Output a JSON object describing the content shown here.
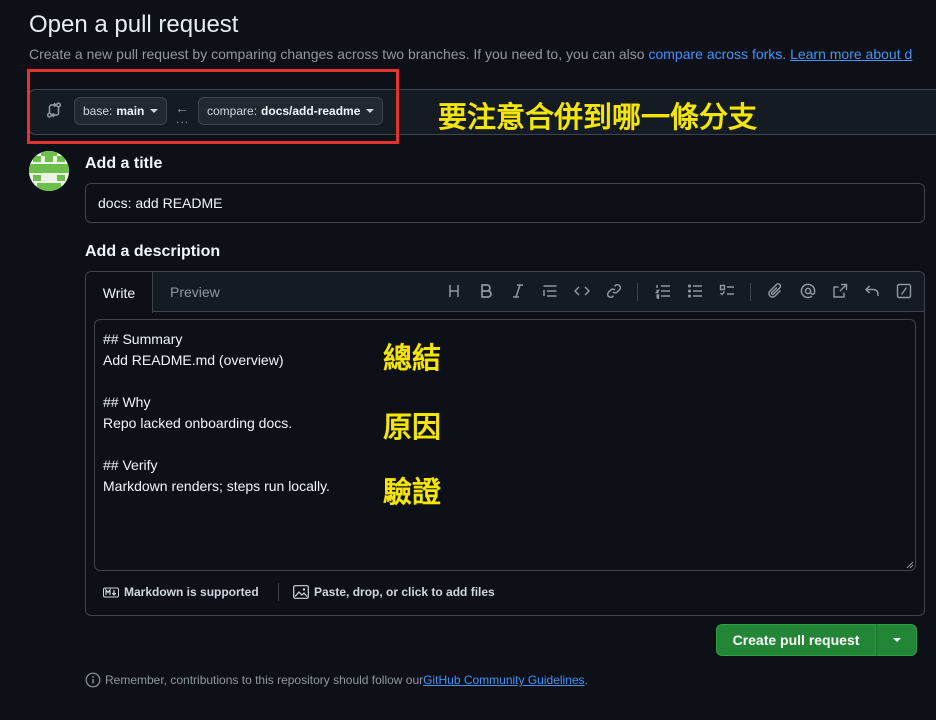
{
  "page": {
    "title": "Open a pull request",
    "subtitle_text": "Create a new pull request by comparing changes across two branches. If you need to, you can also ",
    "subtitle_link1": "compare across forks",
    "subtitle_link2": "Learn more about d"
  },
  "branches": {
    "base_prefix": "base:",
    "base_value": "main",
    "compare_prefix": "compare:",
    "compare_value": "docs/add-readme"
  },
  "annotations": {
    "merge_note": "要注意合併到哪一條分支",
    "summary_note": "總結",
    "why_note": "原因",
    "verify_note": "驗證",
    "color": "#f5e600",
    "box_color": "#e4332e"
  },
  "form": {
    "title_label": "Add a title",
    "title_value": "docs: add README",
    "description_label": "Add a description",
    "tab_write": "Write",
    "tab_preview": "Preview",
    "body_lines": [
      "## Summary",
      "Add README.md (overview)",
      "## Why",
      "Repo lacked onboarding docs.",
      "## Verify",
      "Markdown renders; steps run locally."
    ],
    "markdown_supported": "Markdown is supported",
    "attach_files": "Paste, drop, or click to add files"
  },
  "toolbar": {
    "icons": [
      "heading-icon",
      "bold-icon",
      "italic-icon",
      "quote-icon",
      "code-icon",
      "link-icon",
      "ordered-list-icon",
      "unordered-list-icon",
      "task-list-icon",
      "attach-icon",
      "mention-icon",
      "reference-icon",
      "undo-icon",
      "slash-command-icon"
    ]
  },
  "actions": {
    "create_label": "Create pull request",
    "accent": "#238636"
  },
  "footer": {
    "remember_text": "Remember, contributions to this repository should follow our ",
    "guidelines_link": "GitHub Community Guidelines",
    "period": "."
  }
}
